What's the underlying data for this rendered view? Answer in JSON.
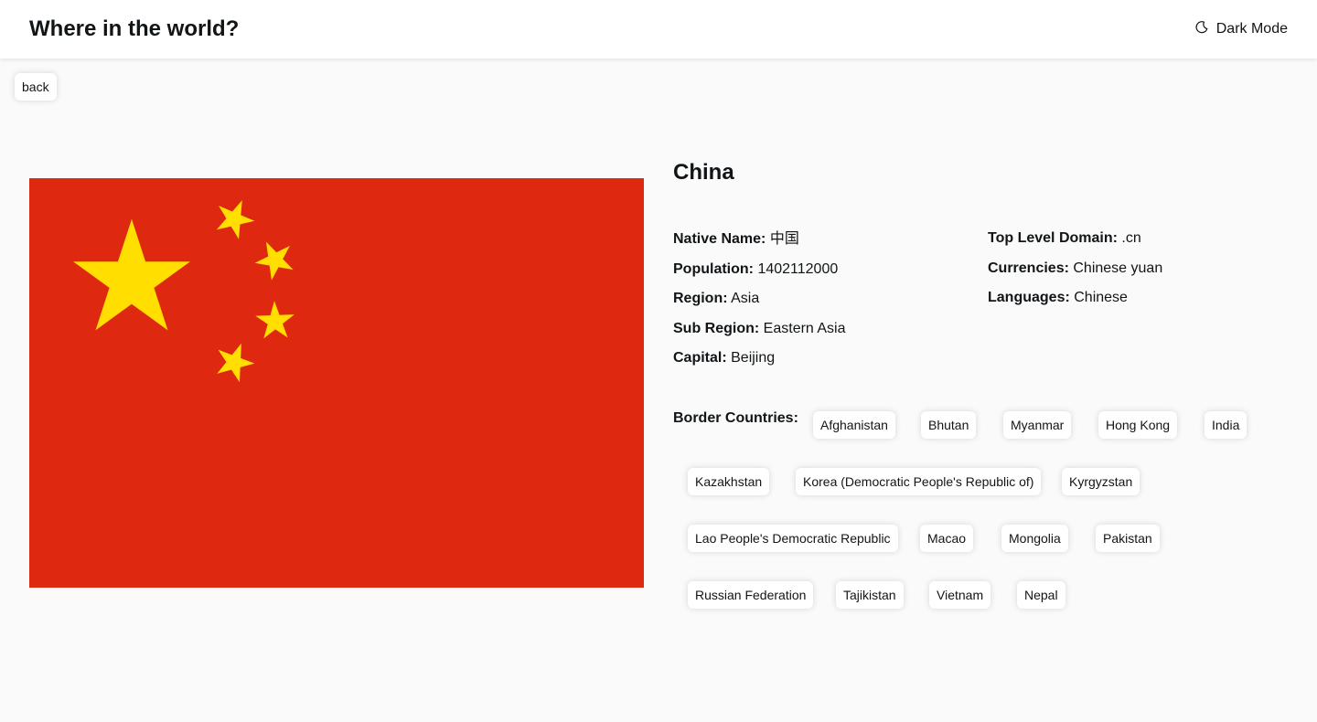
{
  "header": {
    "title": "Where in the world?",
    "mode_label": "Dark Mode",
    "mode_icon": "moon-icon"
  },
  "back_label": "back",
  "flag": {
    "alt": "Flag of China",
    "colors": {
      "field": "#de2910",
      "stars": "#ffde00"
    }
  },
  "country": {
    "name": "China",
    "native_name_label": "Native Name:",
    "native_name": "中国",
    "population_label": "Population:",
    "population": "1402112000",
    "region_label": "Region:",
    "region": "Asia",
    "sub_region_label": "Sub Region:",
    "sub_region": "Eastern Asia",
    "capital_label": "Capital:",
    "capital": "Beijing",
    "tld_label": "Top Level Domain:",
    "tld": ".cn",
    "currencies_label": "Currencies:",
    "currencies": "Chinese yuan",
    "languages_label": "Languages:",
    "languages": "Chinese"
  },
  "borders": {
    "label": "Border Countries:",
    "countries": [
      "Afghanistan",
      "Bhutan",
      "Myanmar",
      "Hong Kong",
      "India",
      "Kazakhstan",
      "Korea (Democratic People's Republic of)",
      "Kyrgyzstan",
      "Lao People's Democratic Republic",
      "Macao",
      "Mongolia",
      "Pakistan",
      "Russian Federation",
      "Tajikistan",
      "Vietnam",
      "Nepal"
    ]
  }
}
